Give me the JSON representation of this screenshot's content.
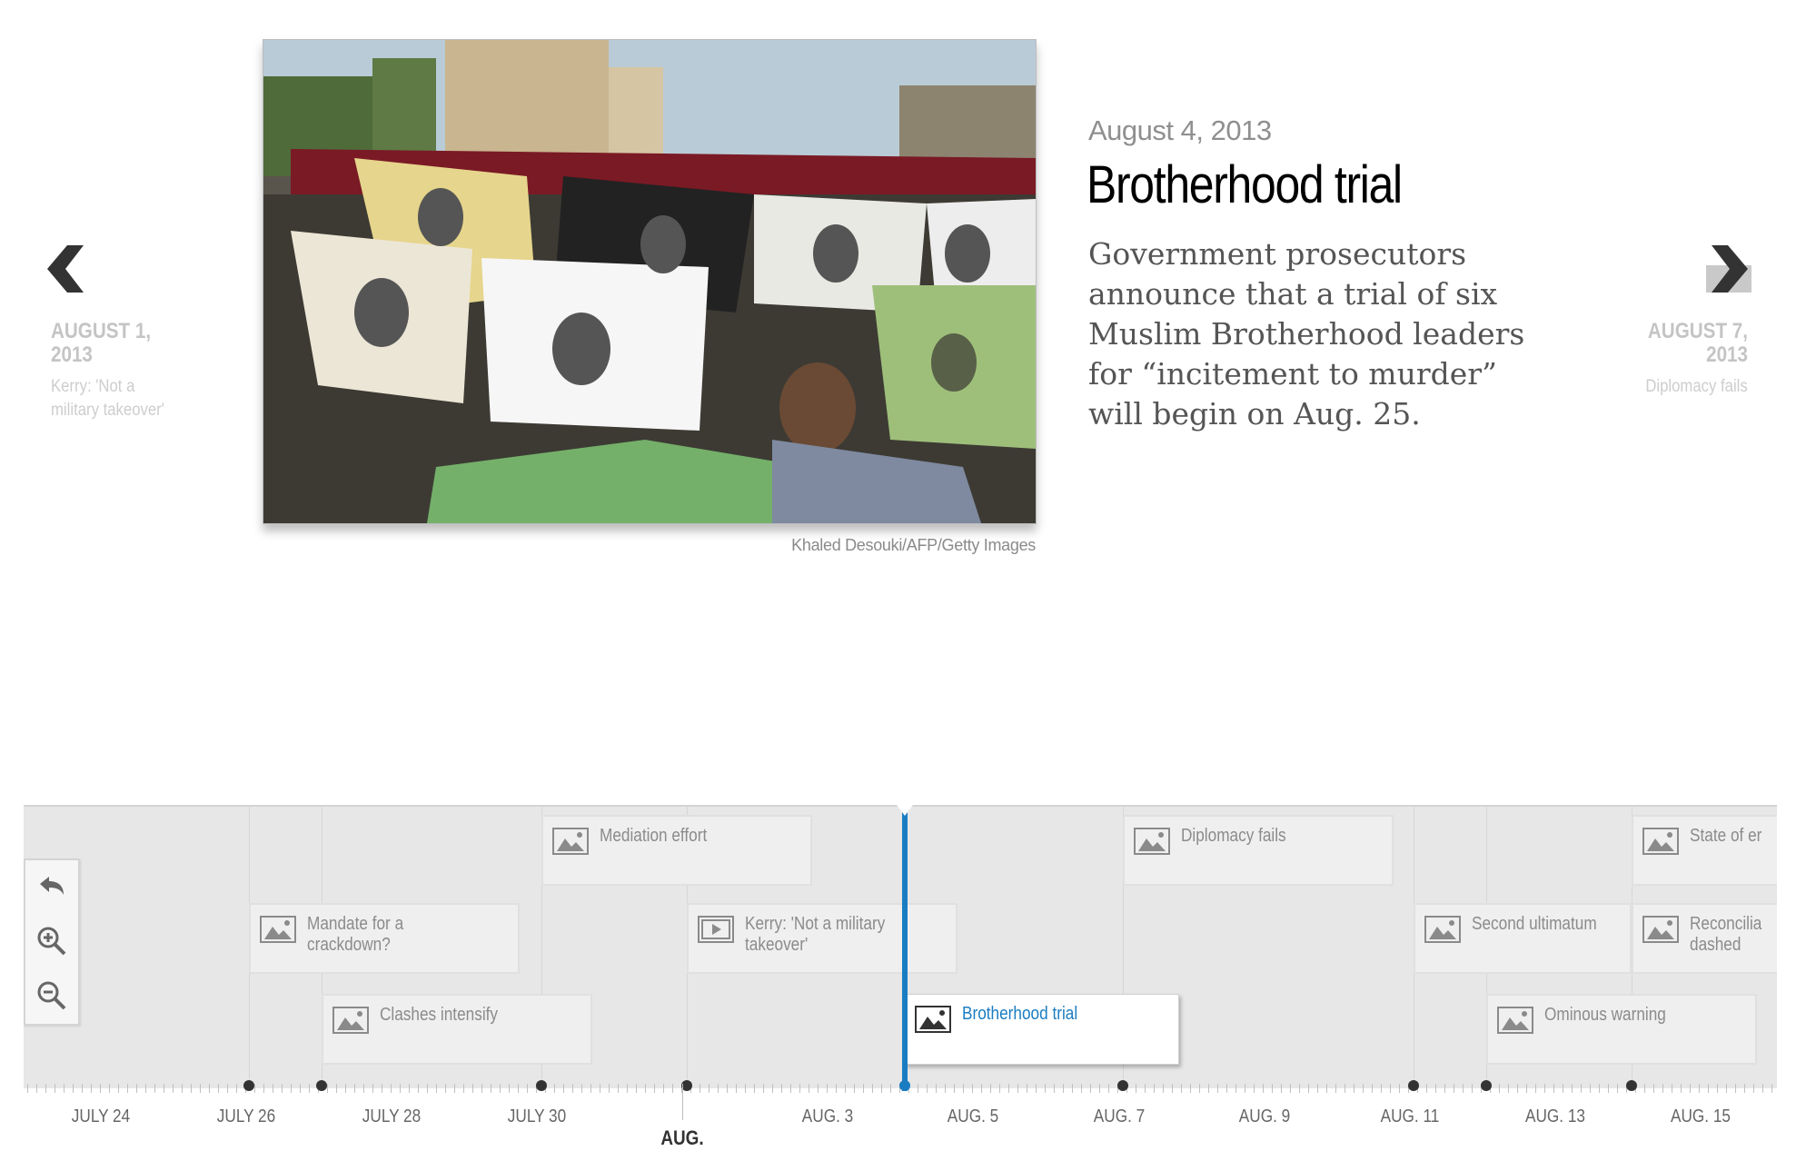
{
  "story": {
    "date": "August 4, 2013",
    "headline": "Brotherhood trial",
    "body": "Government prosecutors announce that a trial of six Muslim Brotherhood leaders for “incitement to murder” will begin on Aug. 25.",
    "photo_credit": "Khaled Desouki/AFP/Getty Images",
    "photo_icon": "photo-market-tshirts"
  },
  "nav": {
    "prev": {
      "date": "AUGUST 1, 2013",
      "title": "Kerry: 'Not a military takeover'",
      "icon": "chevron-left-icon"
    },
    "next": {
      "date": "AUGUST 7, 2013",
      "title": "Diplomacy fails",
      "icon": "chevron-right-icon"
    }
  },
  "timeline": {
    "accent_color": "#1a7dc2",
    "controls": [
      {
        "name": "back",
        "icon": "back-arrow-icon"
      },
      {
        "name": "zoom-in",
        "icon": "zoom-in-icon"
      },
      {
        "name": "zoom-out",
        "icon": "zoom-out-icon"
      }
    ],
    "events": [
      {
        "label": "Mediation effort",
        "kind": "image"
      },
      {
        "label": "Diplomacy fails",
        "kind": "image"
      },
      {
        "label": "State of er",
        "kind": "image"
      },
      {
        "label": "Mandate for a crackdown?",
        "kind": "image"
      },
      {
        "label": "Kerry: 'Not a military takeover'",
        "kind": "video"
      },
      {
        "label": "Second ultimatum",
        "kind": "image"
      },
      {
        "label": "Reconcilia dashed",
        "kind": "image"
      },
      {
        "label": "Clashes intensify",
        "kind": "image"
      },
      {
        "label": "Brotherhood trial",
        "kind": "image",
        "active": true
      },
      {
        "label": "Ominous warning",
        "kind": "image"
      }
    ],
    "axis_labels": [
      "JULY 24",
      "JULY 26",
      "JULY 28",
      "JULY 30",
      "AUG. 3",
      "AUG. 5",
      "AUG. 7",
      "AUG. 9",
      "AUG. 11",
      "AUG. 13",
      "AUG. 15"
    ],
    "month_label": "AUG."
  }
}
